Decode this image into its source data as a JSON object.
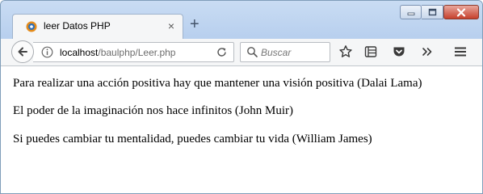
{
  "tab": {
    "title": "leer Datos PHP",
    "close_label": "×",
    "new_tab_label": "+"
  },
  "address": {
    "host": "localhost",
    "path": "/baulphp/Leer.php"
  },
  "search": {
    "placeholder": "Buscar"
  },
  "content": {
    "lines": [
      "Para realizar una acción positiva hay que mantener una visión positiva (Dalai Lama)",
      "El poder de la imaginación nos hace infinitos (John Muir)",
      "Si puedes cambiar tu mentalidad, puedes cambiar tu vida (William James)"
    ]
  },
  "icons": {
    "tab": "php-favicon-icon",
    "back": "back-arrow-icon",
    "info": "info-icon",
    "reload": "reload-icon",
    "search": "search-icon",
    "bookmark": "star-icon",
    "library": "library-icon",
    "pocket": "pocket-icon",
    "overflow": "chevron-double-right-icon",
    "menu": "hamburger-menu-icon"
  }
}
